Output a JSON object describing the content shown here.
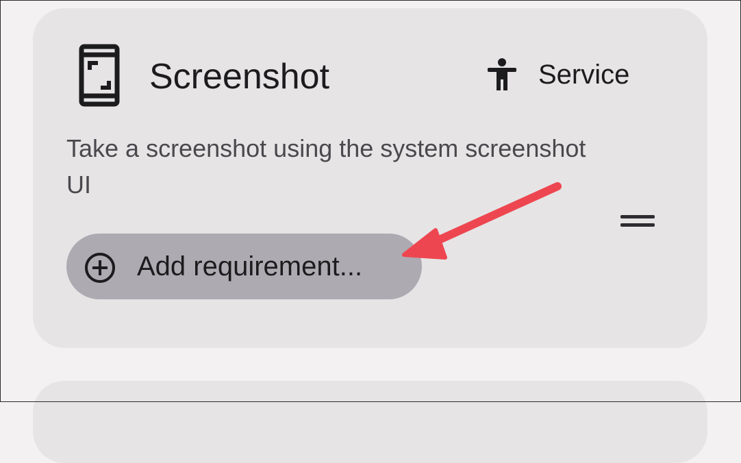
{
  "card": {
    "title": "Screenshot",
    "title_icon": "phone-screenshot-icon",
    "type_icon": "accessibility-icon",
    "type_label": "Service",
    "description": "Take a screenshot using the system screenshot UI",
    "drag_handle_icon": "drag-handle-icon",
    "add_button": {
      "icon": "add-circle-icon",
      "label": "Add requirement..."
    }
  },
  "annotation": {
    "arrow_color": "#ee4650"
  },
  "colors": {
    "background": "#f3f1f2",
    "card": "#e6e4e5",
    "button": "#adaab2",
    "text": "#1c1b1d",
    "secondary_text": "#4b484d"
  }
}
